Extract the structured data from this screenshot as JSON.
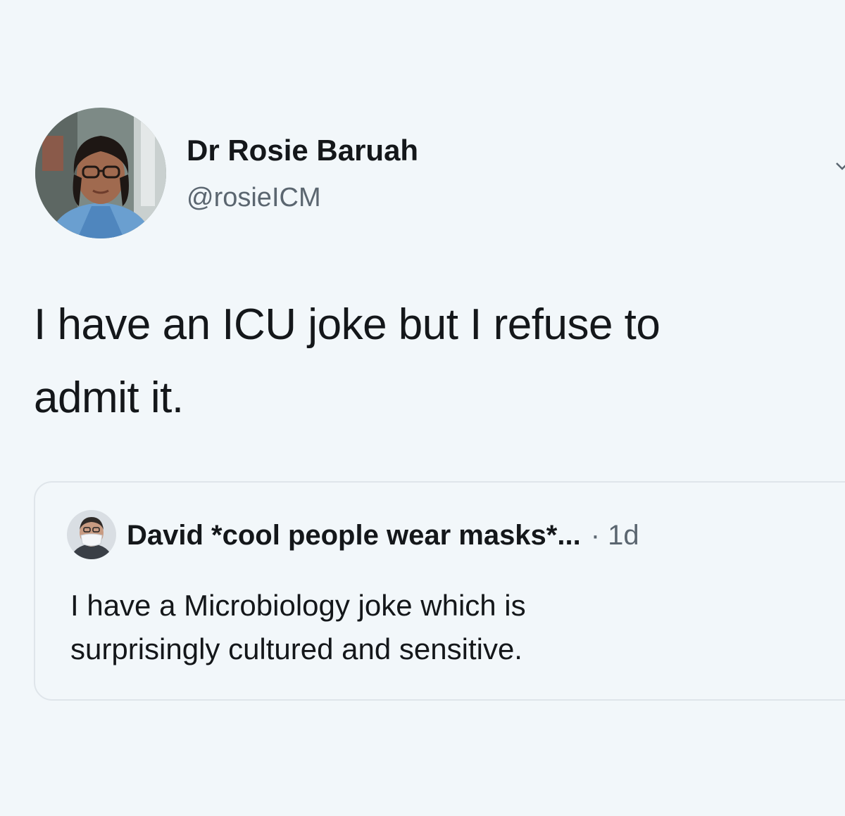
{
  "tweet": {
    "author": {
      "display_name": "Dr Rosie Baruah",
      "handle": "@rosieICM",
      "avatar_icon": "user-avatar-photo"
    },
    "text_line1": "I have an ICU joke but I refuse to",
    "text_line2": "admit it.",
    "menu_icon": "chevron-down-icon"
  },
  "quoted_tweet": {
    "author_name": "David *cool people wear masks*...",
    "timestamp": "· 1d",
    "avatar_icon": "user-avatar-masked-photo",
    "text_line1": "I have a Microbiology joke which is",
    "text_line2": "surprisingly cultured and sensitive."
  },
  "colors": {
    "background": "#f2f7fa",
    "text_primary": "#14171a",
    "text_secondary": "#5b6670",
    "card_border": "#dfe5ea"
  }
}
